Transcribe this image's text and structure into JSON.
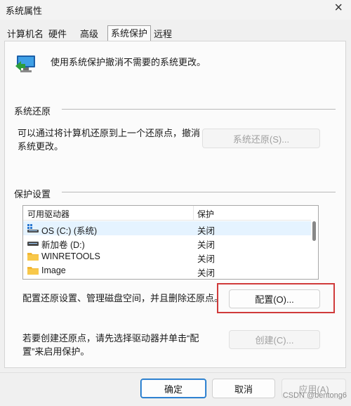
{
  "window": {
    "title": "系统属性",
    "close_symbol": "×"
  },
  "tabs": [
    {
      "label": "计算机名"
    },
    {
      "label": "硬件"
    },
    {
      "label": "高级"
    },
    {
      "label": "系统保护",
      "active": true
    },
    {
      "label": "远程"
    }
  ],
  "intro_text": "使用系统保护撤消不需要的系统更改。",
  "restore_section": {
    "heading": "系统还原",
    "description": "可以通过将计算机还原到上一个还原点，撤消系统更改。",
    "button": "系统还原(S)..."
  },
  "protection_section": {
    "heading": "保护设置",
    "columns": [
      "可用驱动器",
      "保护"
    ],
    "drives": [
      {
        "name": "OS (C:) (系统)",
        "status": "关闭",
        "icon": "system-drive-icon"
      },
      {
        "name": "新加卷 (D:)",
        "status": "关闭",
        "icon": "drive-icon"
      },
      {
        "name": "WINRETOOLS",
        "status": "关闭",
        "icon": "folder-icon"
      },
      {
        "name": "Image",
        "status": "关闭",
        "icon": "folder-icon"
      }
    ],
    "configure_text": "配置还原设置、管理磁盘空间，并且删除还原点。",
    "configure_button": "配置(O)...",
    "create_text": "若要创建还原点，请先选择驱动器并单击“配置”来启用保护。",
    "create_button": "创建(C)..."
  },
  "footer": {
    "ok": "确定",
    "cancel": "取消",
    "apply": "应用(A)"
  },
  "watermark": "CSDN @bentong6",
  "colors": {
    "highlight_box": "#d03a3a",
    "selection": "#e5f3ff",
    "accent": "#0067c0"
  }
}
